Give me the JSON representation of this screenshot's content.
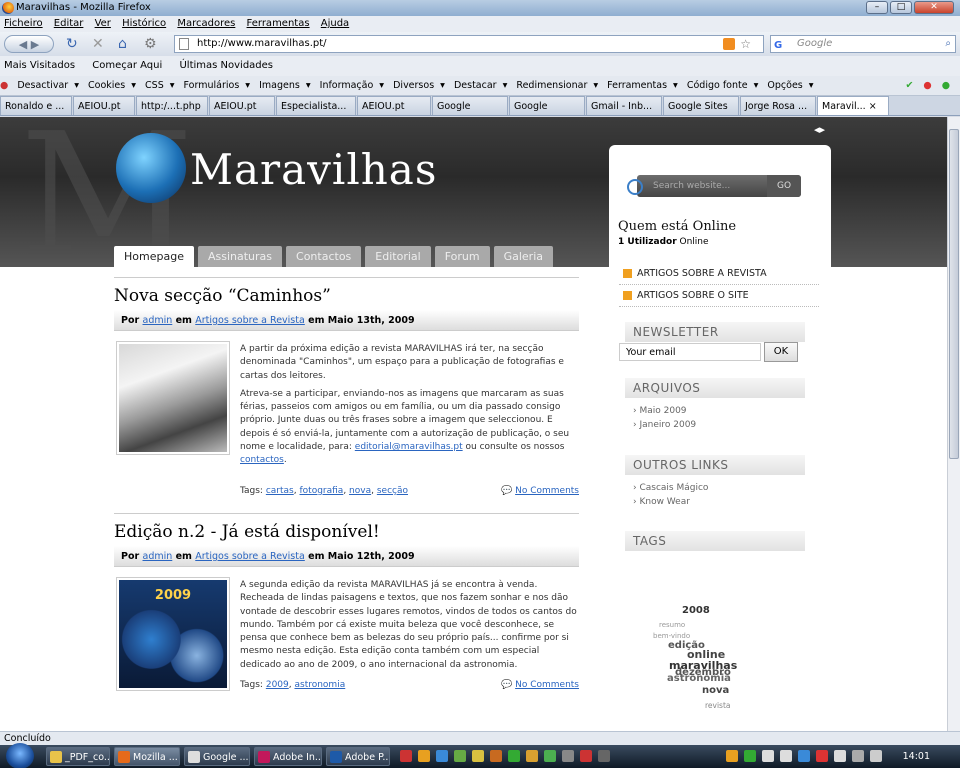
{
  "window": {
    "title": "Maravilhas - Mozilla Firefox"
  },
  "menubar": [
    "Ficheiro",
    "Editar",
    "Ver",
    "Histórico",
    "Marcadores",
    "Ferramentas",
    "Ajuda"
  ],
  "address": {
    "url": "http://www.maravilhas.pt/",
    "search_placeholder": "Google"
  },
  "bookmarks": [
    "Mais Visitados",
    "Começar Aqui",
    "Últimas Novidades"
  ],
  "devbar": [
    "Desactivar",
    "Cookies",
    "CSS",
    "Formulários",
    "Imagens",
    "Informação",
    "Diversos",
    "Destacar",
    "Redimensionar",
    "Ferramentas",
    "Código fonte",
    "Opções"
  ],
  "tabs": [
    {
      "label": "Ronaldo e ..."
    },
    {
      "label": "AEIOU.pt"
    },
    {
      "label": "http:/...t.php"
    },
    {
      "label": "AEIOU.pt"
    },
    {
      "label": "Especialista..."
    },
    {
      "label": "AEIOU.pt"
    },
    {
      "label": "Google"
    },
    {
      "label": "Google"
    },
    {
      "label": "Gmail - Inb..."
    },
    {
      "label": "Google Sites"
    },
    {
      "label": "Jorge Rosa ..."
    },
    {
      "label": "Maravil... ×"
    }
  ],
  "site": {
    "logo": "Maravilhas",
    "nav": [
      "Homepage",
      "Assinaturas",
      "Contactos",
      "Editorial",
      "Forum",
      "Galeria"
    ],
    "posts": [
      {
        "title": "Nova secção “Caminhos”",
        "by": "Por",
        "author": "admin",
        "in": "em",
        "category": "Artigos sobre a Revista",
        "date": "em Maio 13th, 2009",
        "p1": "A partir da próxima edição a revista MARAVILHAS irá ter, na secção denominada \"Caminhos\", um espaço para a publicação de fotografias e cartas dos leitores.",
        "p2": "Atreva-se a participar, enviando-nos as imagens que marcaram as suas férias, passeios com amigos ou em família, ou um dia passado consigo próprio. Junte duas ou três frases sobre a imagem que seleccionou. E depois é só enviá-la, juntamente com a autorização de publicação, o seu nome e localidade, para:",
        "email": "editorial@maravilhas.pt",
        "p2b": "ou consulte os nossos",
        "contact": "contactos",
        "tags_label": "Tags:",
        "tags": [
          "cartas",
          "fotografia",
          "nova",
          "secção"
        ],
        "comments": "No Comments"
      },
      {
        "title": "Edição n.2 - Já está disponível!",
        "by": "Por",
        "author": "admin",
        "in": "em",
        "category": "Artigos sobre a Revista",
        "date": "em Maio 12th, 2009",
        "p1": "A segunda edição da revista MARAVILHAS já se encontra à venda. Recheada de lindas paisagens e textos, que nos fazem sonhar e nos dão vontade de descobrir esses lugares remotos, vindos de todos os cantos do mundo. Também por cá existe muita beleza que você desconhece, se pensa que conhece bem as belezas do seu próprio país... confirme por si mesmo nesta edição. Esta edição conta também com um especial dedicado ao ano de 2009, o ano internacional da astronomia.",
        "cover_year": "2009",
        "tags_label": "Tags:",
        "tags": [
          "2009",
          "astronomia"
        ],
        "comments": "No Comments"
      }
    ],
    "sidebar": {
      "search_placeholder": "Search website...",
      "search_button": "GO",
      "online_title": "Quem está Online",
      "online_count": "1 Utilizador",
      "online_suffix": "Online",
      "links": [
        "ARTIGOS SOBRE A REVISTA",
        "ARTIGOS SOBRE O SITE"
      ],
      "newsletter_title": "NEWSLETTER",
      "newsletter_value": "Your email",
      "newsletter_button": "OK",
      "archives_title": "ARQUIVOS",
      "archives": [
        "Maio 2009",
        "Janeiro 2009"
      ],
      "other_title": "OUTROS LINKS",
      "other_links": [
        "Cascais Mágico",
        "Know Wear"
      ],
      "tags_title": "TAGS",
      "tagcloud": [
        "2008",
        "resumo",
        "edição",
        "bem-vindo",
        "online",
        "maravilhas",
        "dezembro",
        "astronomia",
        "nova",
        "revista"
      ]
    }
  },
  "status": "Concluído",
  "taskbar": {
    "items": [
      "_PDF_co...",
      "Mozilla ...",
      "Google ...",
      "Adobe In...",
      "Adobe P..."
    ],
    "clock": "14:01"
  }
}
